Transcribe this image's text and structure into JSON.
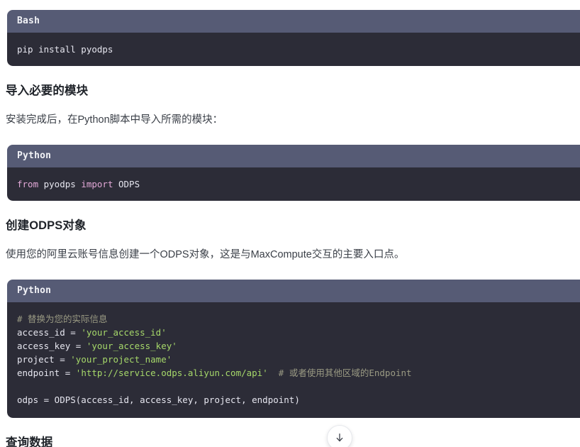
{
  "page": {
    "background": "#ffffff",
    "text_color": "#3a3f47",
    "heading_color": "#1f2329"
  },
  "theme": {
    "code_header_bg": "#565b75",
    "code_body_bg": "#2c2c37",
    "code_text": "#e6e6ef",
    "keyword": "#e3a9d8",
    "string": "#a6d86a",
    "comment": "#9a9a83"
  },
  "blocks": {
    "bash_block": {
      "language_label": "Bash",
      "code_line_1": "pip install pyodps"
    },
    "import_heading": "导入必要的模块",
    "import_paragraph": "安装完成后，在Python脚本中导入所需的模块：",
    "import_block": {
      "language_label": "Python",
      "kw_from": "from",
      "module": " pyodps ",
      "kw_import": "import",
      "symbol": " ODPS"
    },
    "odps_heading": "创建ODPS对象",
    "odps_paragraph": "使用您的阿里云账号信息创建一个ODPS对象，这是与MaxCompute交互的主要入口点。",
    "odps_block": {
      "language_label": "Python",
      "line_comment": "# 替换为您的实际信息",
      "line_access_id_name": "access_id = ",
      "line_access_id_value": "'your_access_id'",
      "line_access_key_name": "access_key = ",
      "line_access_key_value": "'your_access_key'",
      "line_project_name": "project = ",
      "line_project_value": "'your_project_name'",
      "line_endpoint_name": "endpoint = ",
      "line_endpoint_value": "'http://service.odps.aliyun.com/api'",
      "line_endpoint_comment": "  # 或者使用其他区域的Endpoint",
      "line_blank": "",
      "line_constructor": "odps = ODPS(access_id, access_key, project, endpoint)"
    },
    "query_heading": "查询数据"
  },
  "controls": {
    "scroll_down": {
      "icon": "arrow-down-icon",
      "label": "↓"
    }
  }
}
